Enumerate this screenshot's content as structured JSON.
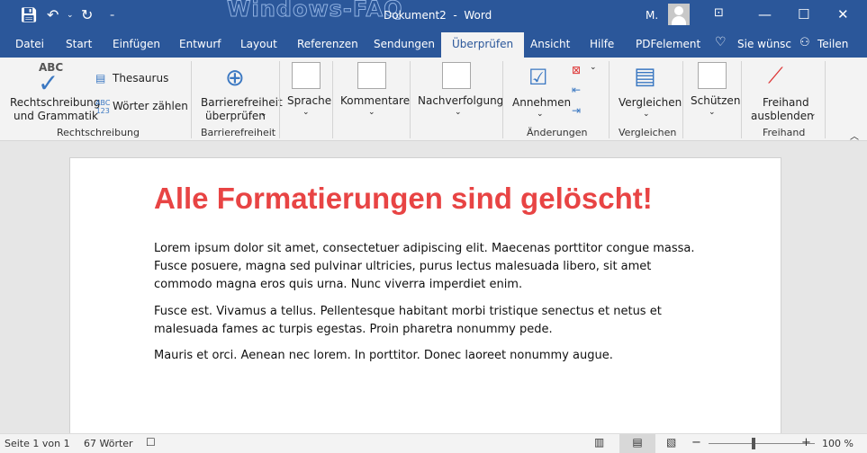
{
  "titlebar": {
    "watermark": "Windows-FAQ",
    "title": "Dokument2  -  Word",
    "user": "M.",
    "icons": [
      "save-icon",
      "undo-icon",
      "redo-icon",
      "customize-icon",
      "ribbon-display-icon",
      "minimize-icon",
      "maximize-icon",
      "close-icon"
    ]
  },
  "tabs": [
    "Datei",
    "Start",
    "Einfügen",
    "Entwurf",
    "Layout",
    "Referenzen",
    "Sendungen",
    "Überprüfen",
    "Ansicht",
    "Hilfe",
    "PDFelement"
  ],
  "active_tab": "Überprüfen",
  "tell_me": "Sie wünsc",
  "share": "Teilen",
  "ribbon": {
    "spelling": "Rechtschreibung",
    "grammar": "und Grammatik",
    "thesaurus": "Thesaurus",
    "wordcount": "Wörter zählen",
    "grp_spelling": "Rechtschreibung",
    "access1": "Barrierefreiheit",
    "access2": "überprüfen",
    "grp_access": "Barrierefreiheit",
    "language": "Sprache",
    "comments": "Kommentare",
    "tracking": "Nachverfolgung",
    "accept": "Annehmen",
    "grp_changes": "Änderungen",
    "compare": "Vergleichen",
    "grp_compare": "Vergleichen",
    "protect": "Schützen",
    "ink1": "Freihand",
    "ink2": "ausblenden",
    "grp_ink": "Freihand"
  },
  "document": {
    "heading": "Alle Formatierungen sind gelöscht!",
    "paragraphs": [
      "Lorem ipsum dolor sit amet, consectetuer adipiscing elit. Maecenas porttitor congue massa. Fusce posuere, magna sed pulvinar ultricies, purus lectus malesuada libero, sit amet commodo magna eros quis urna. Nunc viverra imperdiet enim.",
      "Fusce est. Vivamus a tellus. Pellentesque habitant morbi tristique senectus et netus et malesuada fames ac turpis egestas. Proin pharetra nonummy pede.",
      "Mauris et orci. Aenean nec lorem. In porttitor. Donec laoreet nonummy augue."
    ],
    "heading_color": "#e84444"
  },
  "status": {
    "page": "Seite 1 von 1",
    "words": "67 Wörter",
    "zoom": "100 %",
    "zoom_percent": 100
  },
  "colors": {
    "accent": "#2b579a"
  }
}
